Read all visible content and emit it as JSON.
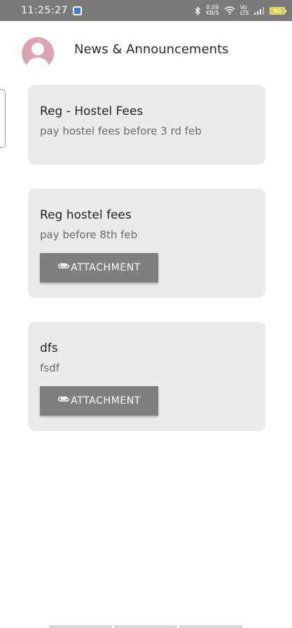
{
  "status_bar": {
    "time": "11:25:27",
    "speed_value": "0.09",
    "speed_unit": "KB/S",
    "net_top": "Vo",
    "net_bottom": "LTE",
    "battery": "80"
  },
  "header": {
    "title": "News & Announcements"
  },
  "announcements": [
    {
      "title": "Reg - Hostel Fees",
      "body": "pay hostel fees before 3 rd feb",
      "attachment_label": null
    },
    {
      "title": "Reg hostel fees",
      "body": "pay before 8th feb",
      "attachment_label": "ATTACHMENT"
    },
    {
      "title": "dfs",
      "body": "fsdf",
      "attachment_label": "ATTACHMENT"
    }
  ],
  "colors": {
    "status_bar": "#7a7a7a",
    "card_bg": "#ebebeb",
    "button_bg": "#7f7f7f",
    "avatar": "#dca4b2"
  },
  "icons": [
    "bluetooth-icon",
    "wifi-icon",
    "signal-icon",
    "battery-icon",
    "avatar-icon",
    "paperclip-icon"
  ]
}
